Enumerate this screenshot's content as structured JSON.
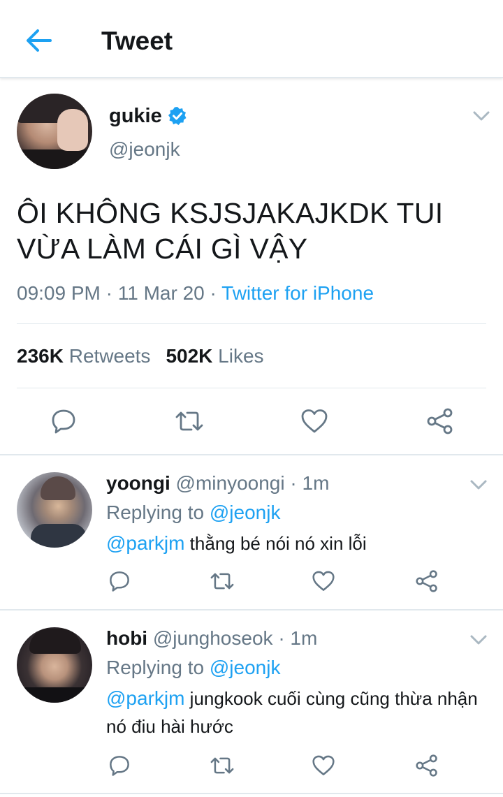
{
  "header": {
    "title": "Tweet",
    "back_icon": "arrow-left-icon",
    "accent": "#1da1f2"
  },
  "main_tweet": {
    "name": "gukie",
    "handle": "@jeonjk",
    "verified": true,
    "text": "ÔI KHÔNG KSJSJAKAJKDK TUI VỪA LÀM CÁI GÌ VẬY",
    "time": "09:09 PM",
    "date": "11 Mar 20",
    "source": "Twitter for iPhone",
    "retweets_count": "236K",
    "retweets_label": "Retweets",
    "likes_count": "502K",
    "likes_label": "Likes",
    "actions": [
      "reply-icon",
      "retweet-icon",
      "like-icon",
      "share-icon"
    ]
  },
  "replies": [
    {
      "name": "yoongi",
      "handle": "@minyoongi",
      "age": "1m",
      "replying_label": "Replying to",
      "replying_to": "@jeonjk",
      "mention": "@parkjm",
      "text": "thằng bé nói nó xin lỗi"
    },
    {
      "name": "hobi",
      "handle": "@junghoseok",
      "age": "1m",
      "replying_label": "Replying to",
      "replying_to": "@jeonjk",
      "mention": "@parkjm",
      "text": "jungkook cuối cùng cũng thừa nhận nó điu hài hước"
    }
  ],
  "separator": "·"
}
